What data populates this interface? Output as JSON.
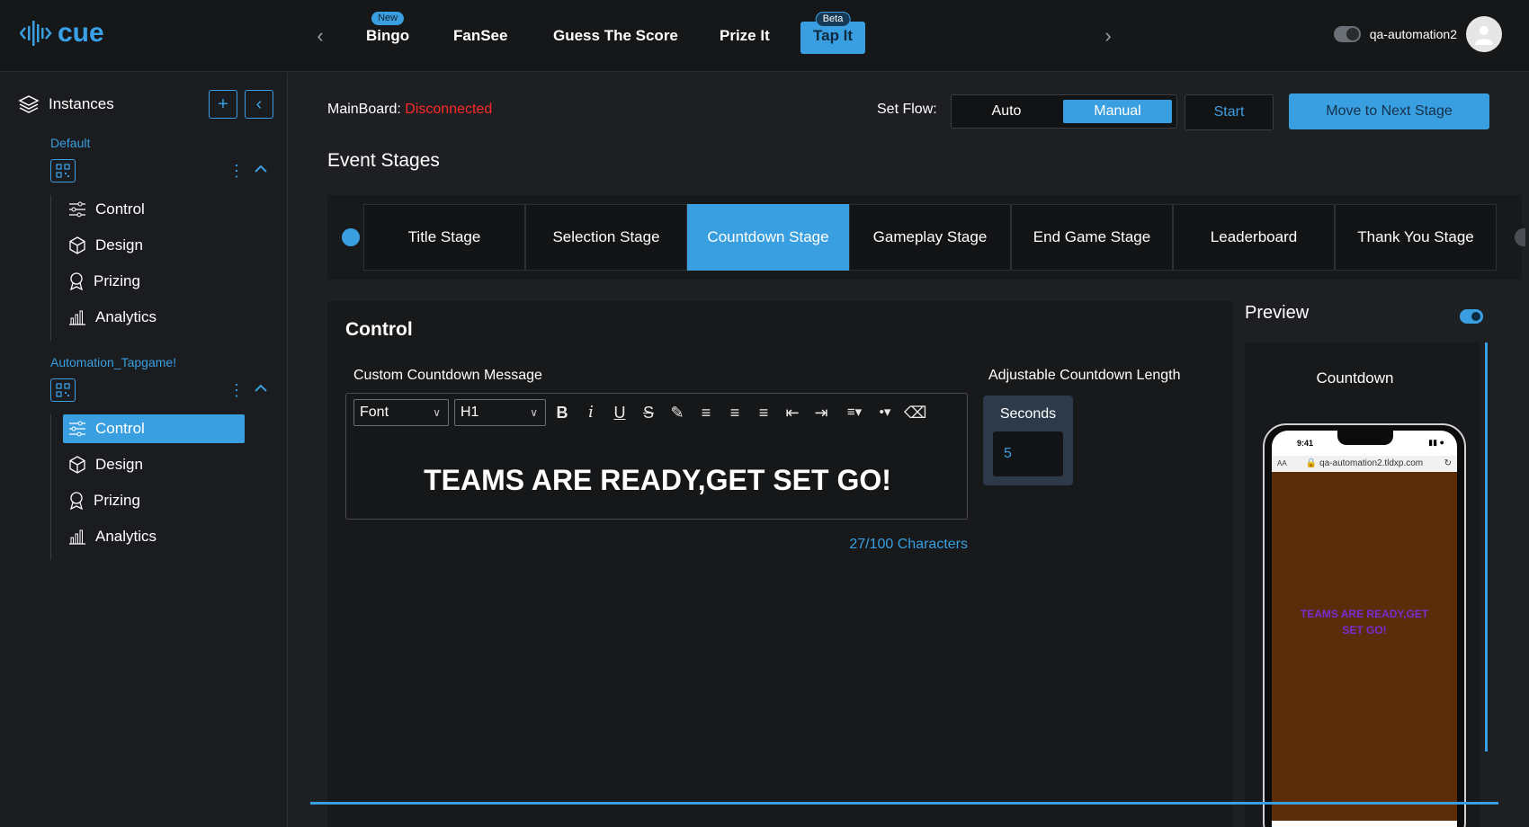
{
  "brand": {
    "name": "cue",
    "accent": "#3a9fe0"
  },
  "topnav": {
    "tabs": [
      {
        "label": "Bingo",
        "badge": "New"
      },
      {
        "label": "FanSee",
        "badge": ""
      },
      {
        "label": "Guess The Score",
        "badge": ""
      },
      {
        "label": "Prize It",
        "badge": ""
      },
      {
        "label": "Tap It",
        "badge": "Beta",
        "active": true
      }
    ],
    "prev_icon": "chevron-left-icon",
    "next_icon": "chevron-right-icon"
  },
  "user": {
    "name": "qa-automation2"
  },
  "sidebar": {
    "title": "Instances",
    "instances": [
      {
        "name": "Default",
        "items": [
          "Control",
          "Design",
          "Prizing",
          "Analytics"
        ],
        "active": ""
      },
      {
        "name": "Automation_Tapgame!",
        "items": [
          "Control",
          "Design",
          "Prizing",
          "Analytics"
        ],
        "active": "Control"
      }
    ]
  },
  "header": {
    "mainboard_label": "MainBoard:",
    "mainboard_status": "Disconnected",
    "setflow_label": "Set Flow:",
    "flow_options": [
      "Auto",
      "Manual"
    ],
    "flow_selected": "Manual",
    "start_label": "Start",
    "next_stage_label": "Move to Next Stage"
  },
  "stages": {
    "title": "Event Stages",
    "items": [
      "Title Stage",
      "Selection Stage",
      "Countdown Stage",
      "Gameplay Stage",
      "End Game Stage",
      "Leaderboard",
      "Thank You Stage"
    ],
    "active": "Countdown Stage"
  },
  "control": {
    "title": "Control",
    "message_label": "Custom Countdown Message",
    "font_select": "Font",
    "heading_select": "H1",
    "message": "TEAMS ARE READY,GET SET GO!",
    "char_count": "27/100 Characters",
    "length_label": "Adjustable Countdown Length",
    "seconds_label": "Seconds",
    "seconds_value": "5"
  },
  "preview": {
    "title": "Preview",
    "enabled": true,
    "screen_label": "Countdown",
    "phone_time": "9:41",
    "phone_url": "qa-automation2.tldxp.com",
    "phone_text_size": "AA",
    "phone_message": "TEAMS ARE READY,GET SET GO!"
  }
}
